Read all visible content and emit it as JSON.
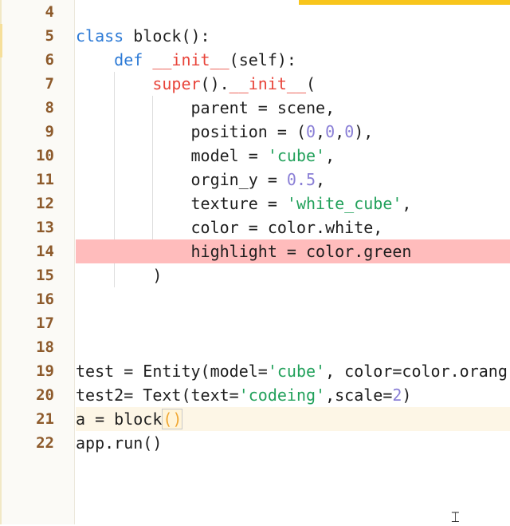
{
  "editor": {
    "accent_color": "#f8c51c",
    "error_highlight_color": "#ffbcbc",
    "current_line_color": "#fdf6e6",
    "cursor_icon": "text-cursor-icon",
    "lines": [
      {
        "num": "4",
        "text": ""
      },
      {
        "num": "5",
        "kw": "class",
        "rest": " block():"
      },
      {
        "num": "6",
        "indent": "    ",
        "kw": "def",
        "sp": "__init__",
        "rest": "(self):"
      },
      {
        "num": "7",
        "indent": "        ",
        "sp": "super",
        "mid": "().",
        "sp2": "__init__",
        "rest": "("
      },
      {
        "num": "8",
        "indent": "            ",
        "text": "parent = scene,"
      },
      {
        "num": "9",
        "indent": "            ",
        "pre": "position = (",
        "n1": "0",
        "c1": ",",
        "n2": "0",
        "c2": ",",
        "n3": "0",
        "post": "),"
      },
      {
        "num": "10",
        "indent": "            ",
        "pre": "model = ",
        "str": "'cube'",
        "post": ","
      },
      {
        "num": "11",
        "indent": "            ",
        "pre": "orgin_y = ",
        "n1": "0.5",
        "post": ","
      },
      {
        "num": "12",
        "indent": "            ",
        "pre": "texture = ",
        "str": "'white_cube'",
        "post": ","
      },
      {
        "num": "13",
        "indent": "            ",
        "text": "color = color.white,"
      },
      {
        "num": "14",
        "indent": "            ",
        "text": "highlight = color.green"
      },
      {
        "num": "15",
        "indent": "        ",
        "text": ")"
      },
      {
        "num": "16",
        "text": ""
      },
      {
        "num": "17",
        "text": ""
      },
      {
        "num": "18",
        "text": ""
      },
      {
        "num": "19",
        "pre": "test = Entity(model=",
        "str": "'cube'",
        "post": ", color=color.orang"
      },
      {
        "num": "20",
        "pre": "test2= Text(text=",
        "str": "'codeing'",
        "mid": ",scale=",
        "n1": "2",
        "post": ")"
      },
      {
        "num": "21",
        "pre": "a = block",
        "brk": "()"
      },
      {
        "num": "22",
        "text": "app.run()"
      }
    ]
  }
}
